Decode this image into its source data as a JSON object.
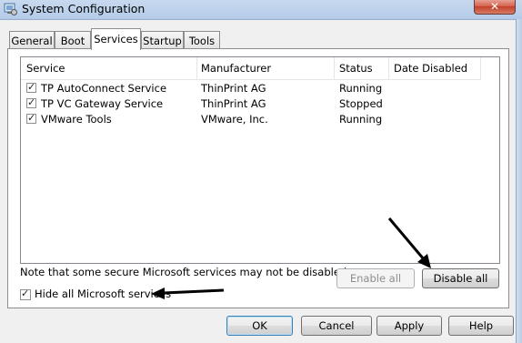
{
  "window": {
    "title": "System Configuration",
    "close_label": "✕"
  },
  "tabs": [
    {
      "label": "General",
      "active": false
    },
    {
      "label": "Boot",
      "active": false
    },
    {
      "label": "Services",
      "active": true
    },
    {
      "label": "Startup",
      "active": false
    },
    {
      "label": "Tools",
      "active": false
    }
  ],
  "services_list": {
    "columns": [
      "Service",
      "Manufacturer",
      "Status",
      "Date Disabled"
    ],
    "rows": [
      {
        "checked": true,
        "service": "TP AutoConnect Service",
        "manufacturer": "ThinPrint AG",
        "status": "Running",
        "date_disabled": ""
      },
      {
        "checked": true,
        "service": "TP VC Gateway Service",
        "manufacturer": "ThinPrint AG",
        "status": "Stopped",
        "date_disabled": ""
      },
      {
        "checked": true,
        "service": "VMware Tools",
        "manufacturer": "VMware, Inc.",
        "status": "Running",
        "date_disabled": ""
      }
    ]
  },
  "note": "Note that some secure Microsoft services may not be disabled.",
  "hide_ms": {
    "label": "Hide all Microsoft services",
    "checked": true
  },
  "buttons": {
    "enable_all": "Enable all",
    "disable_all": "Disable all",
    "ok": "OK",
    "cancel": "Cancel",
    "apply": "Apply",
    "help": "Help"
  },
  "colors": {
    "titlebar": "#c7d9ef",
    "close_button": "#c2402a",
    "annotation_arrow": "#000000"
  },
  "icons": [
    "system-configuration-icon",
    "close-icon",
    "annotation-arrow-icon"
  ]
}
